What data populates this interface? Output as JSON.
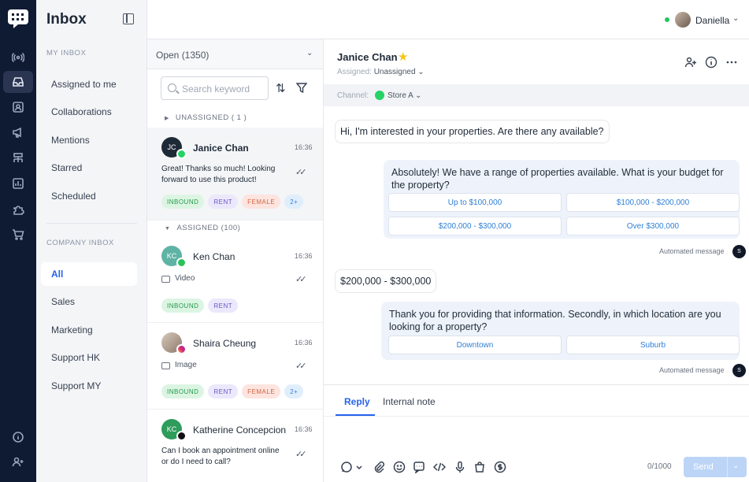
{
  "app": {
    "title": "Inbox",
    "user": {
      "name": "Daniella",
      "status_color": "#22c55e"
    },
    "colors": {
      "rail": "#0f1a33",
      "accent": "#2563eb",
      "out_bubble": "#eef3fb"
    }
  },
  "rail": {
    "icons": [
      "logo-icon",
      "broadcast-icon",
      "inbox-icon",
      "contacts-icon",
      "megaphone-icon",
      "org-chart-icon",
      "analytics-icon",
      "integrations-icon",
      "shop-icon",
      "info-icon",
      "add-user-icon"
    ]
  },
  "sidebar": {
    "my_inbox_label": "MY INBOX",
    "my_items": [
      "Assigned to me",
      "Collaborations",
      "Mentions",
      "Starred",
      "Scheduled"
    ],
    "company_inbox_label": "COMPANY INBOX",
    "company_items": [
      "All",
      "Sales",
      "Marketing",
      "Support HK",
      "Support MY"
    ],
    "active": "All"
  },
  "list": {
    "filter": "Open (1350)",
    "search_placeholder": "Search keyword",
    "group_unassigned": "UNASSIGNED ( 1 )",
    "group_assigned": "ASSIGNED (100)",
    "conversations": [
      {
        "initials": "JC",
        "name": "Janice Chan",
        "time": "16:36",
        "preview": "Great! Thanks so much! Looking forward to use this product!",
        "tags": [
          "INBOUND",
          "RENT",
          "FEMALE",
          "2+"
        ],
        "avatar_color": "#1f2a37",
        "channel": "whatsapp"
      },
      {
        "initials": "KC",
        "name": "Ken Chan",
        "time": "16:36",
        "preview": "Video",
        "tags": [
          "INBOUND",
          "RENT"
        ],
        "avatar_color": "#5fb3a5",
        "channel": "wechat"
      },
      {
        "initials": "",
        "name": "Shaira Cheung",
        "time": "16:36",
        "preview": "Image",
        "tags": [
          "INBOUND",
          "RENT",
          "FEMALE",
          "2+"
        ],
        "avatar_color": "#b9a79a",
        "channel": "instagram"
      },
      {
        "initials": "KC",
        "name": "Katherine Concepcion",
        "time": "16:36",
        "preview": "Can I book an appointment online or do I need to call?",
        "tags": [],
        "avatar_color": "#2e9c5b",
        "channel": "tiktok"
      }
    ]
  },
  "chat": {
    "contact_name": "Janice Chan",
    "assigned_label": "Assigned:",
    "assigned_value": "Unassigned",
    "channel_label": "Channel:",
    "channel_value": "Store A",
    "messages": [
      {
        "dir": "in",
        "text": "Hi, I'm interested in your properties. Are there any available?"
      },
      {
        "dir": "out",
        "text": "Absolutely! We have a range of properties available. What is your budget for the property?",
        "quick_replies": [
          "Up to $100,000",
          "$100,000 - $200,000",
          "$200,000 - $300,000",
          "Over $300,000"
        ],
        "meta": "Automated message"
      },
      {
        "dir": "in",
        "text": "$200,000 - $300,000"
      },
      {
        "dir": "out",
        "text": "Thank you for providing that information. Secondly, in which location are you looking for a property?",
        "quick_replies": [
          "Downtown",
          "Suburb"
        ],
        "meta": "Automated message"
      }
    ],
    "bot_avatar": "S",
    "composer": {
      "tab_reply": "Reply",
      "tab_note": "Internal note",
      "counter": "0/1000",
      "send_label": "Send"
    }
  }
}
